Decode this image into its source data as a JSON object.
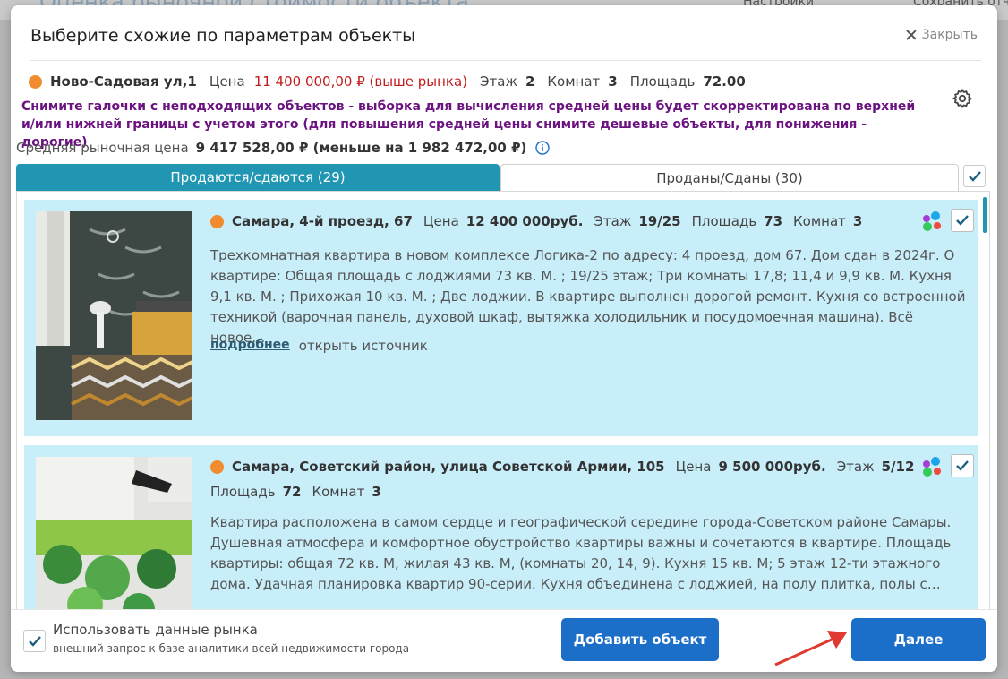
{
  "background": {
    "title": "Оценка рыночной стоимости объекта",
    "settings": "Настройки",
    "right": "Сохранить отчет"
  },
  "modal": {
    "title": "Выберите схожие по параметрам объекты",
    "close_label": "Закрыть"
  },
  "subject": {
    "address": "Ново-Садовая ул,1",
    "price_label": "Цена",
    "price_value": "11 400 000,00 ₽ (выше рынка)",
    "floor_label": "Этаж",
    "floor_value": "2",
    "rooms_label": "Комнат",
    "rooms_value": "3",
    "area_label": "Площадь",
    "area_value": "72.00"
  },
  "warning": "Снимите галочки с неподходящих объектов - выборка для вычисления средней цены будет скорректирована по верхней и/или нижней границы с учетом этого (для повышения средней цены снимите дешевые объекты, для понижения - дорогие)",
  "average": {
    "label": "Средняя рыночная цена",
    "value": "9 417 528,00 ₽ (меньше на 1 982 472,00 ₽)"
  },
  "tabs": {
    "active": "Продаются/сдаются (29)",
    "inactive": "Проданы/Сданы (30)"
  },
  "cards": [
    {
      "address": "Самара, 4-й проезд, 67",
      "price_label": "Цена",
      "price": "12 400 000руб.",
      "floor_label": "Этаж",
      "floor": "19/25",
      "area_label": "Площадь",
      "area": "73",
      "rooms_label": "Комнат",
      "rooms": "3",
      "description": "Трехкомнатная квартира в новом комплексе Логика-2 по адресу: 4 проезд, дом 67. Дом сдан в 2024г. О квартире: Общая площадь с лоджиями 73 кв. М. ; 19/25 этаж; Три комнаты 17,8; 11,4 и 9,9 кв. М. Кухня 9,1 кв. М. ; Прихожая 10 кв. М. ; Две лоджии. В квартире выполнен дорогой ремонт. Кухня со встроенной техникой (варочная панель, духовой шкаф, вытяжка холодильник и посудомоечная машина). Всё новое…",
      "more": "подробнее",
      "source": "открыть источник"
    },
    {
      "address": "Самара, Советский район, улица Советской Армии, 105",
      "price_label": "Цена",
      "price": "9 500 000руб.",
      "floor_label": "Этаж",
      "floor": "5/12",
      "area_label": "Площадь",
      "area": "72",
      "rooms_label": "Комнат",
      "rooms": "3",
      "description": "Квартира расположена в самом сердце и географической середине города-Советском районе Самары. Душевная атмосфера и комфортное обустройство квартиры важны и сочетаются в квартире. Площадь квартиры: общая 72 кв. М, жилая 43 кв. М, (комнаты 20, 14, 9). Кухня 15 кв. М; 5 этаж 12-ти этажного дома. Удачная планировка квартир 90-серии. Кухня объединена с лоджией, на полу плитка, полы с…"
    }
  ],
  "footer": {
    "use_market_label": "Использовать данные рынка",
    "use_market_sub": "внешний запрос к базе аналитики всей недвижимости города",
    "add_button": "Добавить объект",
    "next_button": "Далее"
  },
  "colors": {
    "accent": "#2096b3",
    "button": "#1c6fc8",
    "card_bg": "#c8eefa",
    "warning_text": "#6b1380",
    "price_red": "#c11b1b",
    "dot_orange": "#f08c2e"
  }
}
